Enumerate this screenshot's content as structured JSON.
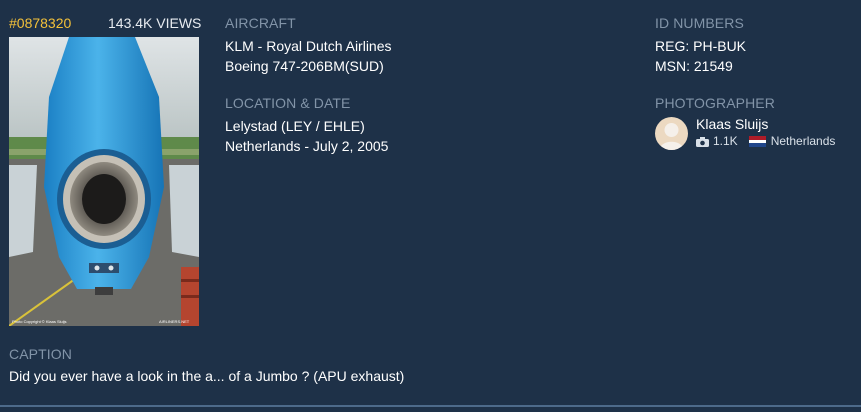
{
  "photo": {
    "id": "#0878320",
    "views": "143.4K VIEWS",
    "watermark_left": "Photo Copyright © Klaas Sluijs",
    "watermark_right": "AIRLINERS.NET"
  },
  "aircraft": {
    "label": "AIRCRAFT",
    "airline": "KLM - Royal Dutch Airlines",
    "type": "Boeing 747-206BM(SUD)"
  },
  "location": {
    "label": "LOCATION & DATE",
    "place": "Lelystad (LEY / EHLE)",
    "country_date": "Netherlands - July 2, 2005"
  },
  "id_numbers": {
    "label": "ID NUMBERS",
    "reg": "REG: PH-BUK",
    "msn": "MSN: 21549"
  },
  "photographer": {
    "label": "PHOTOGRAPHER",
    "name": "Klaas Sluijs",
    "photo_count": "1.1K",
    "country": "Netherlands",
    "camera_icon": "camera-icon",
    "flag_icon": "netherlands-flag-icon"
  },
  "caption": {
    "label": "CAPTION",
    "text": "Did you ever have a look in the a... of a Jumbo ? (APU exhaust)"
  },
  "colors": {
    "background": "#1e3148",
    "label": "#8294a8",
    "accent_id": "#f3c13a"
  }
}
